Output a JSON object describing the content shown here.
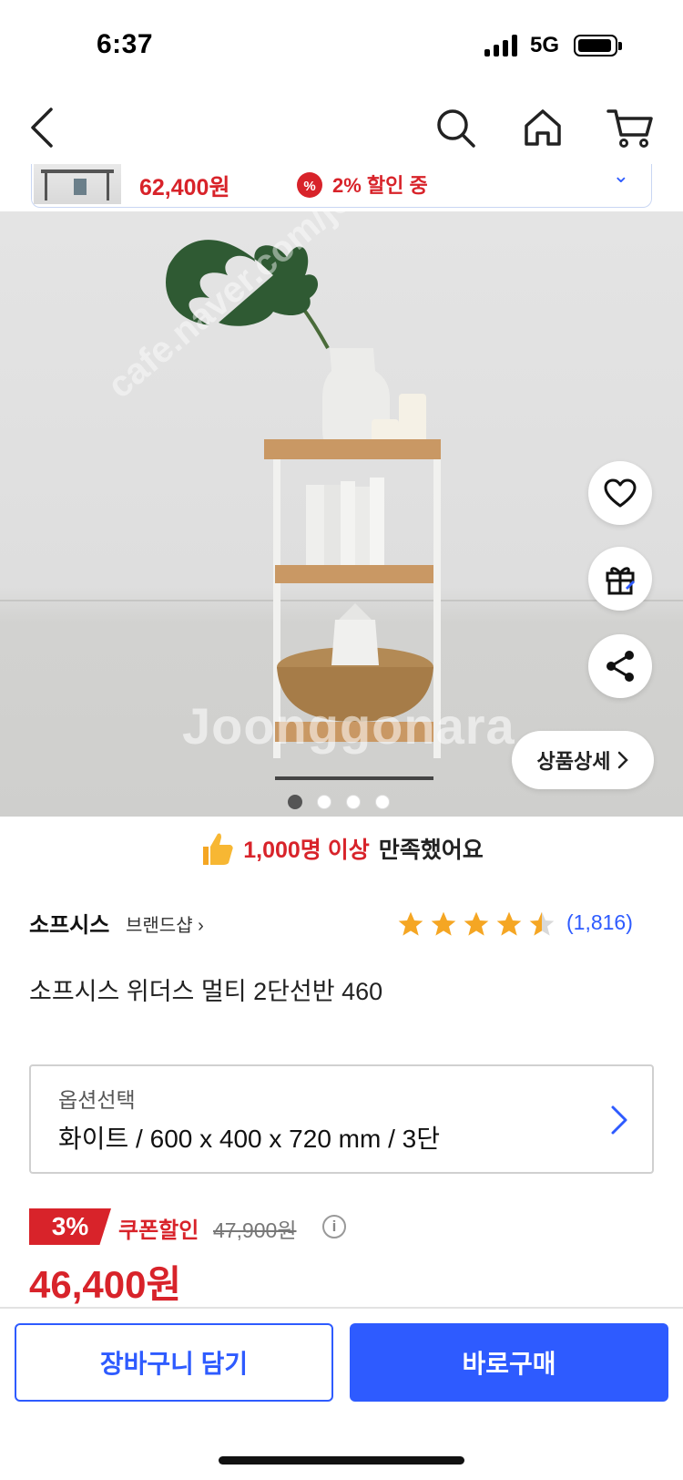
{
  "status_bar": {
    "time": "6:37",
    "network": "5G"
  },
  "nav": {
    "back_icon": "chevron-left-icon",
    "search_icon": "search-icon",
    "home_icon": "home-icon",
    "cart_icon": "cart-icon"
  },
  "mini_bar": {
    "price": "62,400원",
    "discount": "2% 할인 중"
  },
  "hero": {
    "watermark_main": "Joonggonara",
    "watermark_sub": "cafe.naver.com/joonggonara",
    "detail_button": "상품상세",
    "slide_count": 4,
    "active_slide": 1
  },
  "satisfaction": {
    "highlight": "1,000명 이상",
    "rest": "만족했어요"
  },
  "brand": {
    "name": "소프시스",
    "shop_link": "브랜드샵"
  },
  "rating": {
    "stars": 4.5,
    "count": "(1,816)"
  },
  "product": {
    "name": "소프시스 위더스 멀티 2단선반 460"
  },
  "option": {
    "label": "옵션선택",
    "value": "화이트 / 600 x 400 x 720 mm / 3단"
  },
  "price": {
    "discount_badge": "3%",
    "coupon_label": "쿠폰할인",
    "original": "47,900원",
    "final": "46,400원"
  },
  "bottom": {
    "cart_label": "장바구니 담기",
    "buy_label": "바로구매"
  },
  "colors": {
    "accent": "#2e5bff",
    "sale": "#d8232a"
  }
}
